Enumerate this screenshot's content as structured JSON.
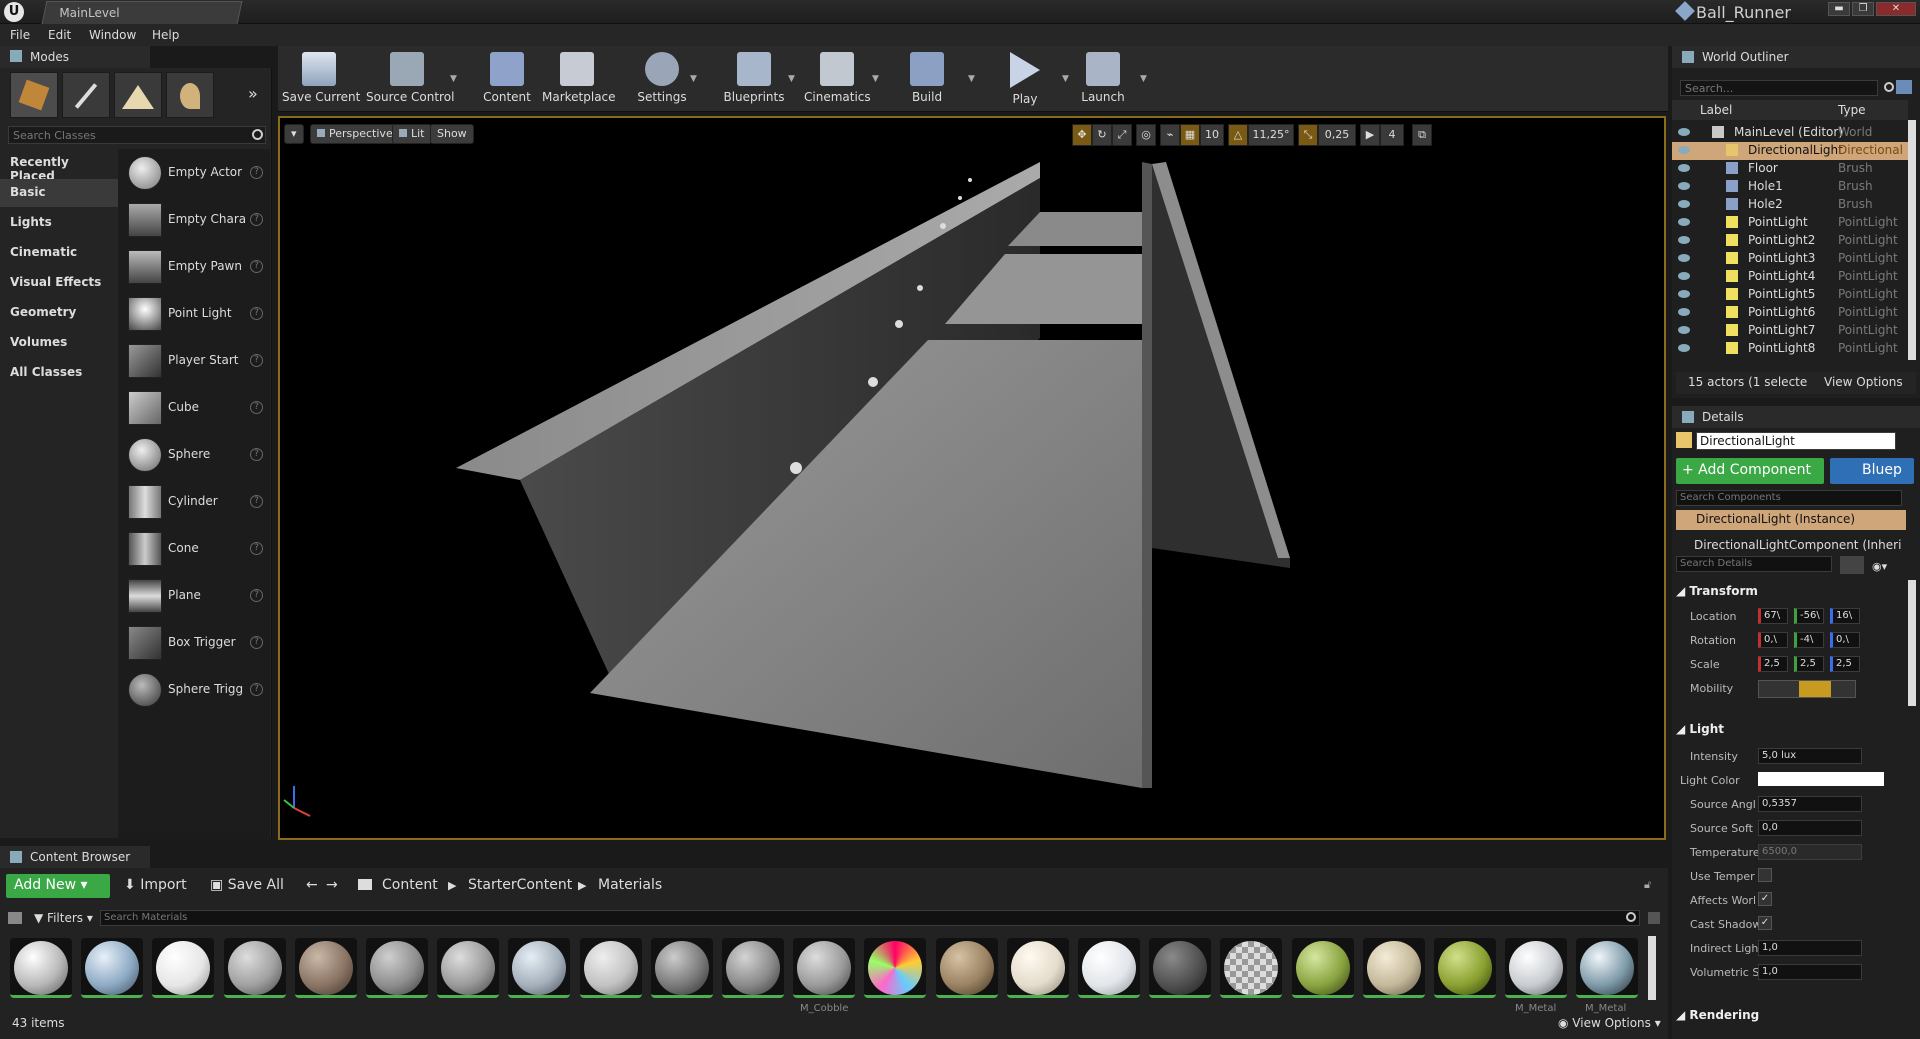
{
  "titlebar": {
    "logo": "U",
    "level_tab": "MainLevel",
    "project": "Ball_Runner",
    "win_min": "▬",
    "win_max": "❐",
    "win_close": "✕"
  },
  "menu": {
    "items": [
      "File",
      "Edit",
      "Window",
      "Help"
    ]
  },
  "modes": {
    "tab": "Modes",
    "search_placeholder": "Search Classes",
    "categories": [
      "Recently Placed",
      "Basic",
      "Lights",
      "Cinematic",
      "Visual Effects",
      "Geometry",
      "Volumes",
      "All Classes"
    ],
    "items": [
      "Empty Actor",
      "Empty Chara",
      "Empty Pawn",
      "Point Light",
      "Player Start",
      "Cube",
      "Sphere",
      "Cylinder",
      "Cone",
      "Plane",
      "Box Trigger",
      "Sphere Trigg"
    ]
  },
  "toolbar": {
    "buttons": [
      "Save Current",
      "Source Control",
      "Content",
      "Marketplace",
      "Settings",
      "Blueprints",
      "Cinematics",
      "Build",
      "Play",
      "Launch"
    ]
  },
  "viewport": {
    "perspective": "Perspective",
    "lit": "Lit",
    "show": "Show",
    "grid_snap": "10",
    "rot_snap": "11,25°",
    "scale_snap": "0,25",
    "cam_speed": "4",
    "accent": "#f0a020"
  },
  "outliner": {
    "tab": "World Outliner",
    "search_placeholder": "Search...",
    "col_label": "Label",
    "col_type": "Type",
    "rows": [
      {
        "label": "MainLevel (Editor)",
        "type": "World"
      },
      {
        "label": "DirectionalLight",
        "type": "Directional"
      },
      {
        "label": "Floor",
        "type": "Brush"
      },
      {
        "label": "Hole1",
        "type": "Brush"
      },
      {
        "label": "Hole2",
        "type": "Brush"
      },
      {
        "label": "PointLight",
        "type": "PointLight"
      },
      {
        "label": "PointLight2",
        "type": "PointLight"
      },
      {
        "label": "PointLight3",
        "type": "PointLight"
      },
      {
        "label": "PointLight4",
        "type": "PointLight"
      },
      {
        "label": "PointLight5",
        "type": "PointLight"
      },
      {
        "label": "PointLight6",
        "type": "PointLight"
      },
      {
        "label": "PointLight7",
        "type": "PointLight"
      },
      {
        "label": "PointLight8",
        "type": "PointLight"
      }
    ],
    "status": "15 actors (1 selecte",
    "view_options": "View Options"
  },
  "details": {
    "tab": "Details",
    "name": "DirectionalLight",
    "add_component": "+ Add Component",
    "blueprint": "Bluep",
    "search_components": "Search Components",
    "instance": "DirectionalLight (Instance)",
    "component": "DirectionalLightComponent (Inheri",
    "search_details": "Search Details",
    "transform": "Transform",
    "location_label": "Location",
    "rotation_label": "Rotation",
    "scale_label": "Scale",
    "mobility_label": "Mobility",
    "location": [
      "67\\",
      "-56\\",
      "16\\"
    ],
    "rotation": [
      "0,\\",
      "-4\\",
      "0,\\"
    ],
    "scale": [
      "2,5",
      "2,5",
      "2,5"
    ],
    "light": "Light",
    "intensity_label": "Intensity",
    "intensity": "5,0 lux",
    "light_color_label": "Light Color",
    "source_angle_label": "Source Angl",
    "source_angle": "0,5357",
    "source_soft_label": "Source Soft",
    "source_soft": "0,0",
    "temperature_label": "Temperature",
    "temperature": "6500,0",
    "use_temp_label": "Use Temper",
    "affects_world_label": "Affects Worl",
    "cast_shadows_label": "Cast Shadow",
    "indirect_label": "Indirect Ligh",
    "indirect": "1,0",
    "volumetric_label": "Volumetric S",
    "volumetric": "1,0",
    "rendering": "Rendering"
  },
  "content_browser": {
    "tab": "Content Browser",
    "add_new": "Add New",
    "import": "Import",
    "save_all": "Save All",
    "path": [
      "Content",
      "StarterContent",
      "Materials"
    ],
    "filters": "Filters",
    "search_placeholder": "Search Materials",
    "items_count": "43 items",
    "view_options": "View Options",
    "partial_labels": [
      "M_Cobble",
      "M_Metal",
      "M_Metal"
    ]
  }
}
